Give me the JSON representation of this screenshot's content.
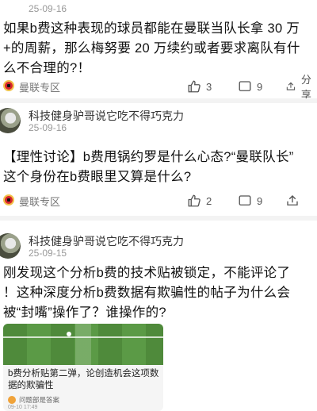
{
  "posts": [
    {
      "author": "",
      "date": "25-09-16",
      "body_lines": [
        "如果b费这种表现的球员都能在曼联当队长拿 30 万",
        "+的周薪，那么梅努要 20 万续约或者要求离队有什",
        "么不合理的?！"
      ],
      "tag": "曼联专区",
      "likes": "3",
      "comments": "9",
      "share_label": "分享"
    },
    {
      "author": "科技健身驴哥说它吃不得巧克力",
      "date": "25-09-16",
      "body_lines": [
        "【理性讨论】b费甩锅约罗是什么心态?“曼联队长”",
        "这个身份在b费眼里又算是什么?"
      ],
      "tag": "曼联专区",
      "likes": "2",
      "comments": "9",
      "share_label": ""
    },
    {
      "author": "科技健身驴哥说它吃不得巧克力",
      "date": "25-09-15",
      "body_lines": [
        "刚发现这个分析b费的技术贴被锁定，不能评论了",
        "！这种深度分析b费数据有欺骗性的帖子为什么会",
        "被“封嘴”操作了？谁操作的?"
      ],
      "card": {
        "title": "b费分析贴第二弹，论创造机会这项数据的欺骗性",
        "author": "问题部是答案",
        "date": "09-10 17:49"
      }
    }
  ],
  "colors": {
    "separator": "#f3f3f3",
    "meta_gray": "#999999",
    "club_red": "#d8262c"
  },
  "icons": [
    "club-badge-icon",
    "like-icon",
    "comment-icon",
    "share-icon"
  ]
}
